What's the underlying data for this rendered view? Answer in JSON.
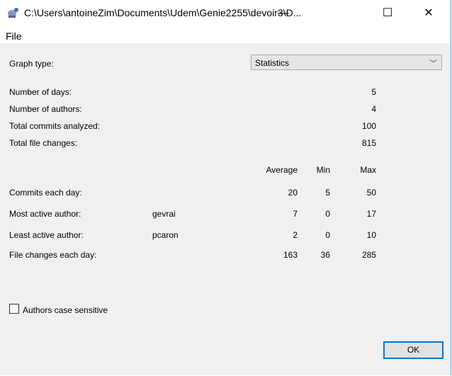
{
  "window": {
    "title": "C:\\Users\\antoineZim\\Documents\\Udem\\Genie2255\\devoir3\\D...",
    "minimize": "—",
    "maximize": "☐",
    "close": "✕"
  },
  "menu": {
    "file": "File"
  },
  "graph_type": {
    "label": "Graph type:",
    "value": "Statistics",
    "arrow": "﹀"
  },
  "summary": [
    {
      "label": "Number of days:",
      "value": "5"
    },
    {
      "label": "Number of authors:",
      "value": "4"
    },
    {
      "label": "Total commits analyzed:",
      "value": "100"
    },
    {
      "label": "Total file changes:",
      "value": "815"
    }
  ],
  "headers": {
    "average": "Average",
    "min": "Min",
    "max": "Max"
  },
  "stats": [
    {
      "label": "Commits each day:",
      "name": "",
      "avg": "20",
      "min": "5",
      "max": "50"
    },
    {
      "label": "Most active author:",
      "name": "gevrai",
      "avg": "7",
      "min": "0",
      "max": "17"
    },
    {
      "label": "Least active author:",
      "name": "pcaron",
      "avg": "2",
      "min": "0",
      "max": "10"
    },
    {
      "label": "File changes each day:",
      "name": "",
      "avg": "163",
      "min": "36",
      "max": "285"
    }
  ],
  "checkbox": {
    "label": "Authors case sensitive",
    "checked": false
  },
  "ok": "OK"
}
